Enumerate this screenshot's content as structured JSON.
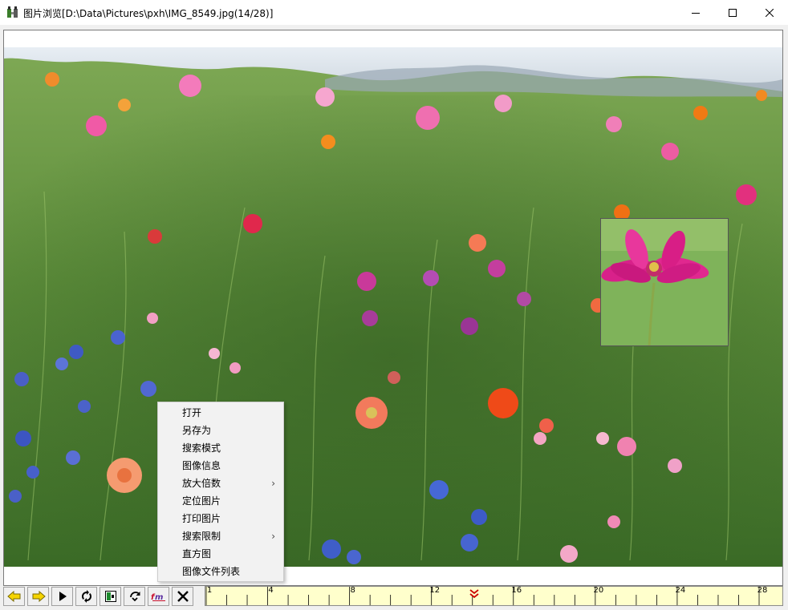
{
  "window": {
    "title": "图片浏览[D:\\Data\\Pictures\\pxh\\IMG_8549.jpg(14/28)]",
    "icon": "picture-viewer-icon",
    "controls": [
      "minimize-icon",
      "maximize-icon",
      "close-icon"
    ]
  },
  "image": {
    "description_icon": "photo-flower-meadow",
    "magnifier_icon": "magnified-pink-cosmos"
  },
  "context_menu": {
    "items": [
      {
        "label": "打开",
        "submenu": false
      },
      {
        "label": "另存为",
        "submenu": false
      },
      {
        "label": "搜索模式",
        "submenu": false
      },
      {
        "label": "图像信息",
        "submenu": false
      },
      {
        "label": "放大倍数",
        "submenu": true
      },
      {
        "label": "定位图片",
        "submenu": false
      },
      {
        "label": "打印图片",
        "submenu": false
      },
      {
        "label": "搜索限制",
        "submenu": true
      },
      {
        "label": "直方图",
        "submenu": false
      },
      {
        "label": "图像文件列表",
        "submenu": false
      }
    ],
    "submenu_arrow": "›"
  },
  "toolbar": {
    "buttons": [
      {
        "icon": "previous-arrow-icon"
      },
      {
        "icon": "next-arrow-icon"
      },
      {
        "icon": "play-icon"
      },
      {
        "icon": "sync-icon"
      },
      {
        "icon": "fit-window-icon"
      },
      {
        "icon": "rotate-icon"
      },
      {
        "icon": "rename-icon"
      },
      {
        "icon": "delete-x-icon"
      }
    ]
  },
  "timeline": {
    "min": 1,
    "max": 28,
    "current": 14,
    "tick_labels": [
      "1",
      "4",
      "8",
      "12",
      "16",
      "20",
      "24",
      "28"
    ],
    "marker_color": "#cc0000",
    "background": "#ffffcc"
  }
}
